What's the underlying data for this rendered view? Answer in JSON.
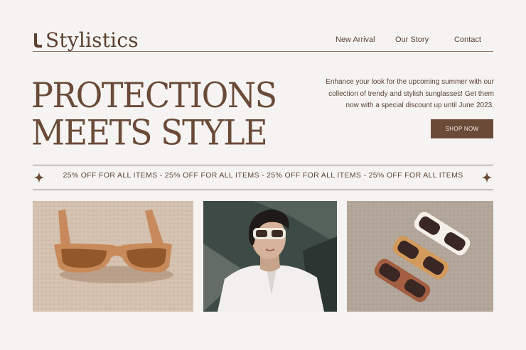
{
  "brand": {
    "name": "Stylistics"
  },
  "nav": {
    "items": [
      {
        "label": "New Arrival"
      },
      {
        "label": "Our Story"
      },
      {
        "label": "Contact"
      }
    ]
  },
  "hero": {
    "title_lines": [
      "PROTECTIONS",
      "MEETS STYLE"
    ],
    "description": "Enhance your look for the upcoming summer with our collection of trendy and stylish sunglasses! Get them now with a special discount up until June 2023.",
    "cta_label": "SHOP NOW"
  },
  "promo": {
    "text": "25% OFF FOR ALL ITEMS - 25% OFF FOR ALL ITEMS - 25% OFF FOR ALL ITEMS - 25% OFF FOR ALL ITEMS"
  },
  "gallery": {
    "images": [
      {
        "icon": "sunglasses-on-sand-photo"
      },
      {
        "icon": "woman-wearing-sunglasses-photo"
      },
      {
        "icon": "three-sunglasses-flatlay-photo"
      }
    ]
  },
  "colors": {
    "background": "#f5f4f2",
    "brand_brown": "#6b4a38",
    "text": "#5c4030",
    "button_text": "#f5eee8"
  }
}
